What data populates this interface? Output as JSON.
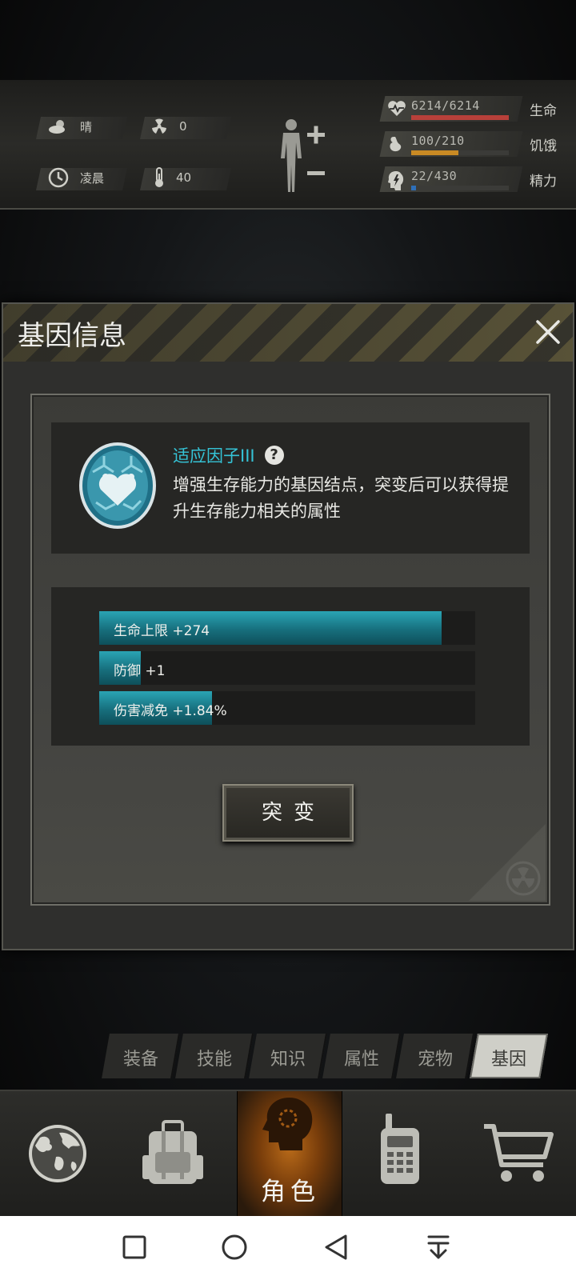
{
  "status": {
    "weather": "晴",
    "radiation": "0",
    "time_of_day": "凌晨",
    "temperature": "40"
  },
  "vitals": [
    {
      "value": "6214/6214",
      "label": "生命",
      "fill": 1.0,
      "color": "#b8403a",
      "icon": "heart-pulse-icon"
    },
    {
      "value": "100/210",
      "label": "饥饿",
      "fill": 0.48,
      "color": "#c98a24",
      "icon": "stomach-icon"
    },
    {
      "value": "22/430",
      "label": "精力",
      "fill": 0.05,
      "color": "#2e6fb8",
      "icon": "energy-head-icon"
    }
  ],
  "modal": {
    "title": "基因信息",
    "gene_name": "适应因子III",
    "description": "增强生存能力的基因结点，突变后可以获得提升生存能力相关的属性",
    "bonuses": [
      {
        "text": "生命上限 +274",
        "fill": 0.91
      },
      {
        "text": "防御 +1",
        "fill": 0.11
      },
      {
        "text": "伤害减免 +1.84%",
        "fill": 0.3
      }
    ],
    "mutate_label": "突变"
  },
  "tabs": [
    "装备",
    "技能",
    "知识",
    "属性",
    "宠物",
    "基因"
  ],
  "active_tab": "基因",
  "nav": {
    "role_label": "角色"
  }
}
